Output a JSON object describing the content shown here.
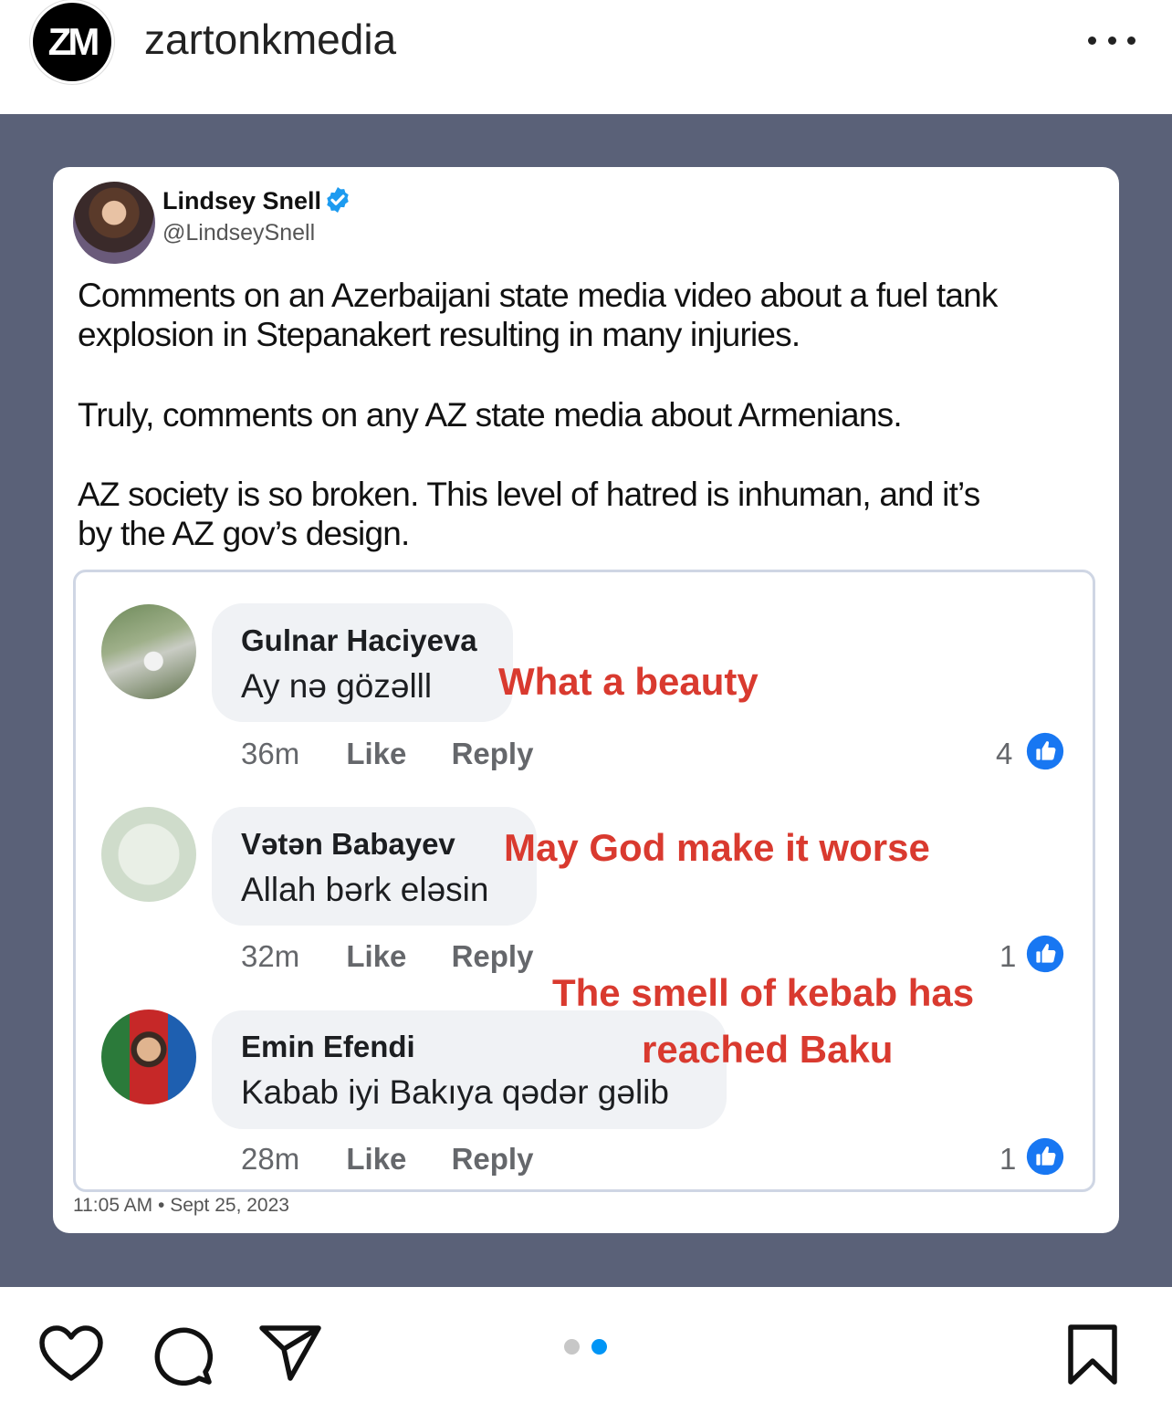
{
  "header": {
    "avatar_text": "ZM",
    "username": "zartonkmedia",
    "more_icon": "more-horizontal-icon"
  },
  "tweet": {
    "name": "Lindsey Snell",
    "handle": "@LindseySnell",
    "verified_icon": "verified-badge-icon",
    "paragraphs": [
      "Comments on an Azerbaijani state media video about a fuel tank",
      "explosion in Stepanakert resulting in many injuries.",
      "Truly, comments on any AZ state media about Armenians.",
      "AZ society is so broken. This level of hatred is inhuman, and it’s",
      "by the AZ gov’s design."
    ],
    "timestamp": "11:05 AM • Sept 25, 2023"
  },
  "comments": [
    {
      "name": "Gulnar Haciyeva",
      "text": "Ay nə gözəlll",
      "time": "36m",
      "like": "Like",
      "reply": "Reply",
      "likes": "4",
      "translation": "What a beauty"
    },
    {
      "name": "Vətən Babayev",
      "text": "Allah bərk eləsin",
      "time": "32m",
      "like": "Like",
      "reply": "Reply",
      "likes": "1",
      "translation": "May God make it worse"
    },
    {
      "name": "Emin Efendi",
      "text": "Kabab iyi Bakıya qədər gəlib",
      "time": "28m",
      "like": "Like",
      "reply": "Reply",
      "likes": "1",
      "translation_line1": "The smell of kebab has",
      "translation_line2": "reached Baku"
    }
  ],
  "actions": {
    "like_icon": "heart-icon",
    "comment_icon": "comment-icon",
    "share_icon": "send-icon",
    "save_icon": "bookmark-icon",
    "carousel_total": 2,
    "carousel_active": 2
  },
  "colors": {
    "image_background": "#5a6178",
    "translation_red": "#d93a2f",
    "facebook_blue": "#1877f2",
    "twitter_blue": "#1d9bf0",
    "carousel_active": "#0095f6",
    "carousel_inactive": "#c7c7c7"
  }
}
